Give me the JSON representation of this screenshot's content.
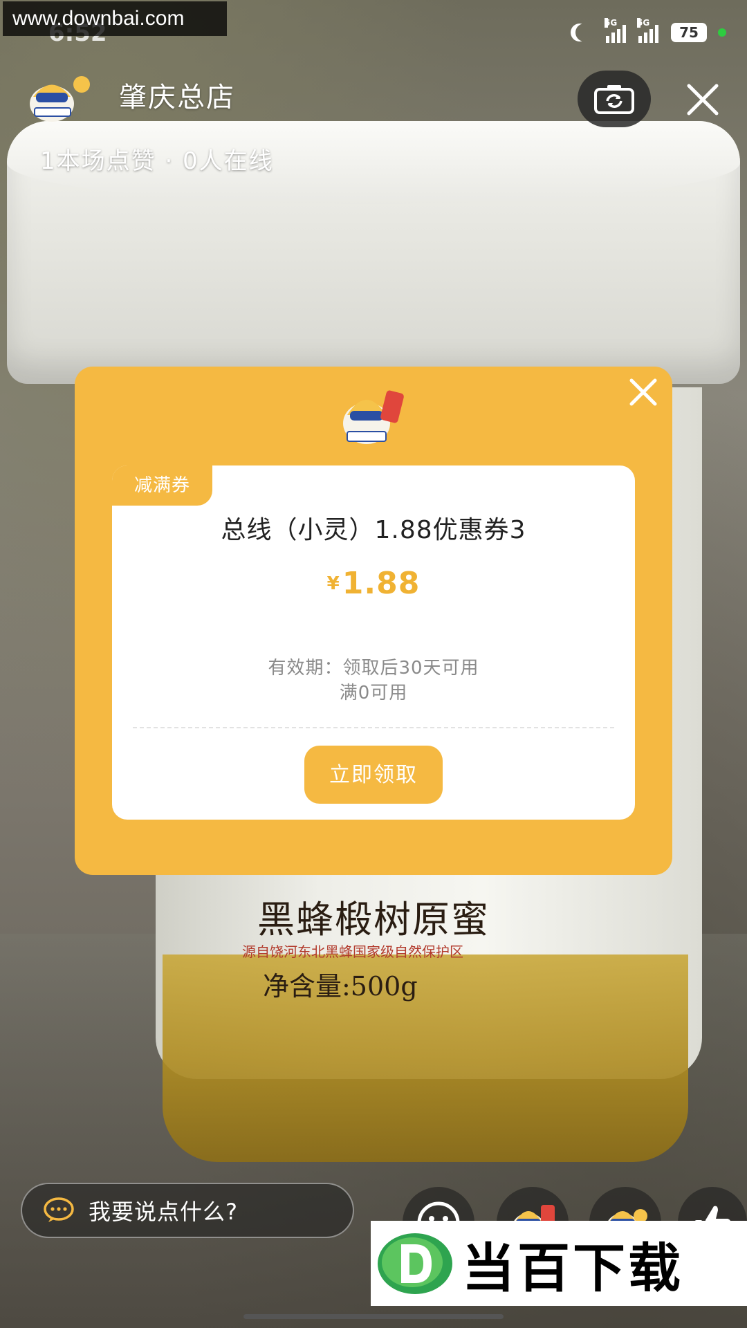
{
  "watermark": "www.downbai.com",
  "status_bar": {
    "time": "6:52",
    "network_1": "5G",
    "network_2": "5G",
    "battery": "75"
  },
  "header": {
    "store_name": "肇庆总店",
    "stats": "1本场点赞 · 0人在线"
  },
  "product_label": {
    "name": "黑蜂椴树原蜜",
    "subtitle": "源自饶河东北黑蜂国家级自然保护区",
    "net_weight": "净含量:500g"
  },
  "coupon": {
    "tag": "减满券",
    "title": "总线（小灵）1.88优惠券3",
    "currency": "¥",
    "amount": "1.88",
    "validity_line1": "有效期：领取后30天可用",
    "validity_line2": "满0可用",
    "claim_label": "立即领取",
    "accent_color": "#f5b942"
  },
  "chat": {
    "placeholder": "我要说点什么?"
  },
  "brand_banner": {
    "text": "当百下载"
  },
  "icons": [
    "camera-flip-icon",
    "close-icon",
    "chat-bubble-icon",
    "emoji-icon",
    "coupon-mascot-icon",
    "gift-mascot-icon",
    "thumbs-up-icon"
  ]
}
